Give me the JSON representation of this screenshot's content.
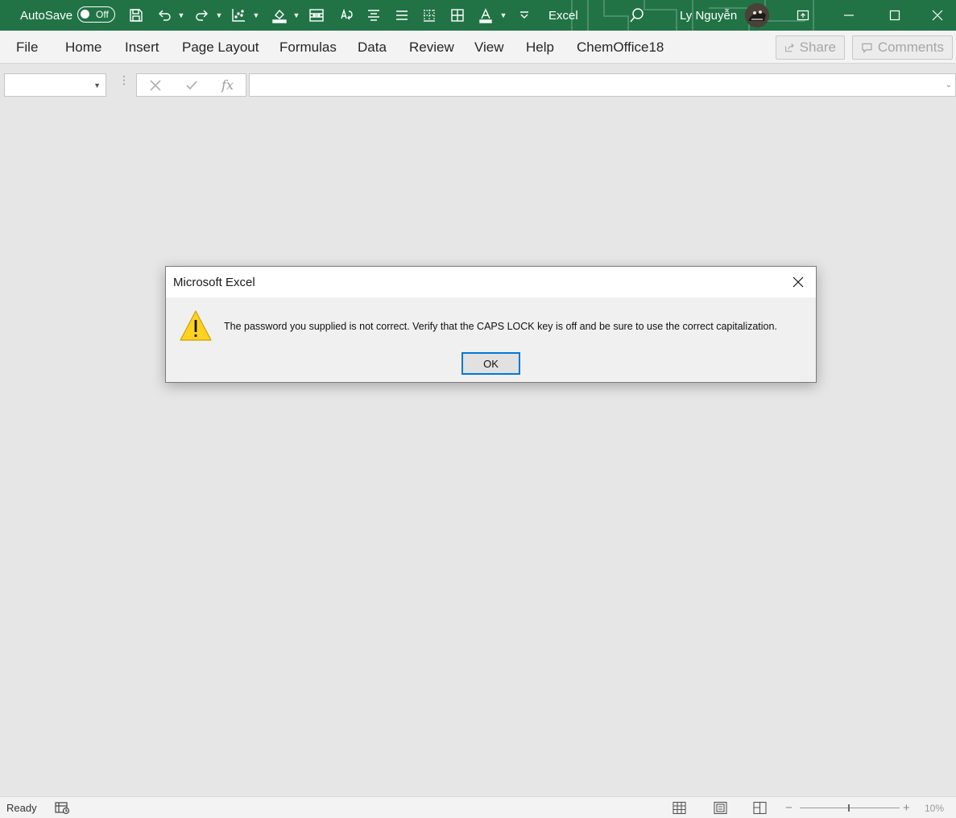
{
  "titlebar": {
    "autosave_label": "AutoSave",
    "autosave_state": "Off",
    "app_title": "Excel",
    "user_name": "Ly Nguyễn"
  },
  "ribbon": {
    "tabs": [
      "File",
      "Home",
      "Insert",
      "Page Layout",
      "Formulas",
      "Data",
      "Review",
      "View",
      "Help",
      "ChemOffice18"
    ],
    "share_label": "Share",
    "comments_label": "Comments"
  },
  "formula_bar": {
    "name_box_value": "",
    "fx_label": "fx",
    "formula_value": ""
  },
  "dialog": {
    "title": "Microsoft Excel",
    "message": "The password you supplied is not correct. Verify that the CAPS LOCK key is off and be sure to use the correct capitalization.",
    "ok_label": "OK"
  },
  "statusbar": {
    "status": "Ready",
    "zoom": "10%"
  },
  "colors": {
    "brand": "#217346",
    "ribbon_bg": "#f3f3f3",
    "workspace_bg": "#e6e6e6",
    "focus": "#0078d7",
    "warning": "#ffd21f"
  }
}
